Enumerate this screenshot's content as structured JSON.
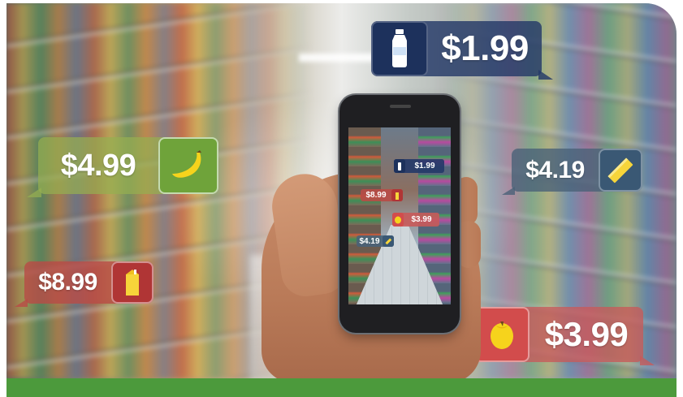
{
  "price_tags": {
    "bottle": {
      "price": "$1.99",
      "icon": "water-bottle-icon",
      "color": "#243968"
    },
    "banana": {
      "price": "$4.99",
      "icon": "banana-icon",
      "color": "#6fa33a"
    },
    "butter": {
      "price": "$4.19",
      "icon": "butter-stick-icon",
      "color": "#3a5874"
    },
    "drink": {
      "price": "$8.99",
      "icon": "drink-carton-icon",
      "color": "#b03535"
    },
    "fruit": {
      "price": "$3.99",
      "icon": "fruit-icon",
      "color": "#d24c4c"
    }
  },
  "phone_screen_tags": {
    "bottle": "$1.99",
    "drink": "$8.99",
    "fruit": "$3.99",
    "butter": "$4.19"
  },
  "colors": {
    "band": "#4c9a3c"
  }
}
